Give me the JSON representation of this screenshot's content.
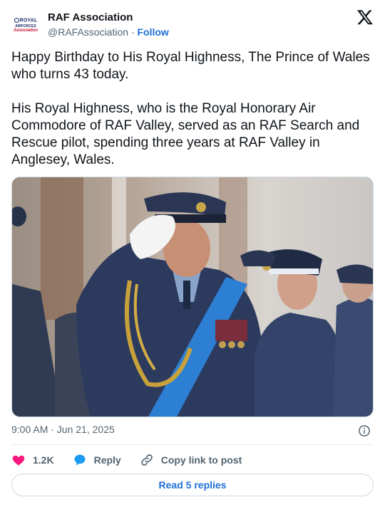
{
  "account": {
    "name": "RAF Association",
    "handle": "@RAFAssociation",
    "separator": "·",
    "follow_label": "Follow",
    "logo_text": {
      "line1": "ROYAL",
      "line2": "AIRFORCES",
      "line3": "Association"
    }
  },
  "post": {
    "paragraphs": [
      "Happy Birthday to His Royal Highness, The Prince of Wales who turns 43 today.",
      "His Royal Highness, who is the Royal Honorary Air Commodore of RAF Valley, served as an RAF Search and Rescue pilot, spending three years at RAF Valley in Anglesey, Wales."
    ],
    "timestamp": "9:00 AM · Jun 21, 2025"
  },
  "actions": {
    "likes": "1.2K",
    "reply_label": "Reply",
    "copy_label": "Copy link to post"
  },
  "footer": {
    "read_replies_label": "Read 5 replies"
  },
  "colors": {
    "like": "#f91880",
    "reply": "#1d9bf0",
    "link": "#1d6fd6"
  }
}
